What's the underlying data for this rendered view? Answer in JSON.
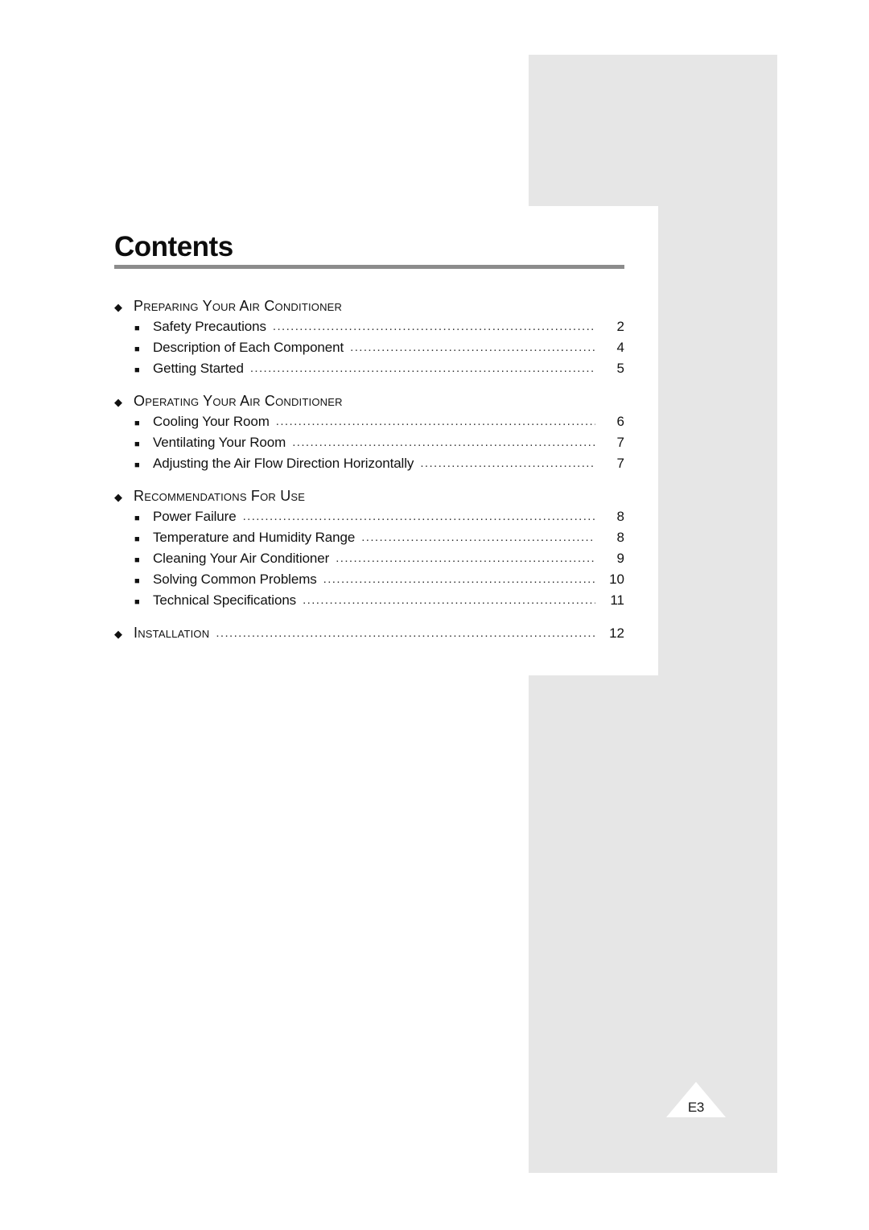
{
  "page": {
    "marker_label": "E3",
    "accent_rule_color": "#8c8c8c",
    "panel_color": "#e6e6e6",
    "text_color": "#111111"
  },
  "contents": {
    "title": "Contents",
    "groups": [
      {
        "heading": "Preparing Your Air Conditioner",
        "heading_page": "",
        "leader": "..........................................................................................................",
        "entries": [
          {
            "label": "Safety Precautions",
            "leader": "............................................................................................",
            "page": "2"
          },
          {
            "label": "Description of Each Component",
            "leader": "..........................................................................",
            "page": "4"
          },
          {
            "label": "Getting Started",
            "leader": "..................................................................................................",
            "page": "5"
          }
        ]
      },
      {
        "heading": "Operating Your Air Conditioner",
        "heading_page": "",
        "leader": "..........................................................................................................",
        "entries": [
          {
            "label": "Cooling Your Room",
            "leader": "...........................................................................................",
            "page": "6"
          },
          {
            "label": "Ventilating Your Room",
            "leader": "......................................................................................",
            "page": "7"
          },
          {
            "label": "Adjusting the Air Flow Direction Horizontally",
            "leader": "...........................................",
            "page": "7"
          }
        ]
      },
      {
        "heading": "Recommendations For Use",
        "heading_page": "",
        "leader": "..........................................................................................................",
        "entries": [
          {
            "label": "Power Failure",
            "leader": "....................................................................................................",
            "page": "8"
          },
          {
            "label": "Temperature and Humidity Range",
            "leader": "..................................................................",
            "page": "8"
          },
          {
            "label": "Cleaning Your Air Conditioner",
            "leader": "........................................................................",
            "page": "9"
          },
          {
            "label": "Solving Common Problems",
            "leader": "..........................................................................",
            "page": "10"
          },
          {
            "label": "Technical Specifications",
            "leader": "...............................................................................",
            "page": "11"
          }
        ]
      }
    ],
    "final_section": {
      "heading": "Installation",
      "leader": "...................................................................................................",
      "page": "12"
    }
  },
  "icons": {
    "diamond_bullet": "◆",
    "square_bullet": "■"
  }
}
